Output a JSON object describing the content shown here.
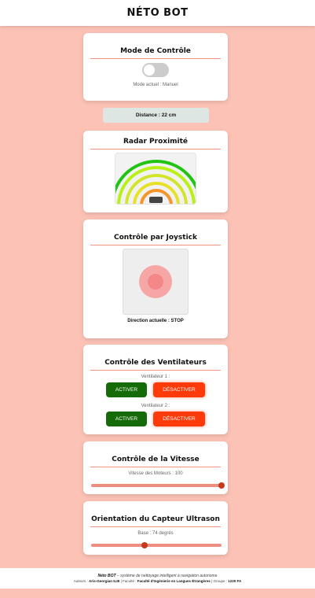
{
  "app": {
    "title": "NÉTO BOT"
  },
  "mode_card": {
    "title": "Mode de Contrôle",
    "status": "Mode actuel : Manuel",
    "toggle_on": false
  },
  "distance": {
    "text": "Distance : 22 cm"
  },
  "radar_card": {
    "title": "Radar Proximité",
    "arc_colors": [
      "#f5962a",
      "#d3e52b",
      "#b9f018",
      "#22c414"
    ]
  },
  "joystick_card": {
    "title": "Contrôle par Joystick",
    "direction": "Direction actuelle : STOP"
  },
  "fans_card": {
    "title": "Contrôle des Ventilateurs",
    "fans": [
      {
        "label": "Ventilateur 1 :",
        "on_label": "ACTIVER",
        "off_label": "DÉSACTIVER"
      },
      {
        "label": "Ventilateur 2 :",
        "on_label": "ACTIVER",
        "off_label": "DÉSACTIVER"
      }
    ]
  },
  "speed_card": {
    "title": "Contrôle de la Vitesse",
    "label": "Vitesse des Moteurs : 100",
    "value_fraction": 1.0
  },
  "sensor_card": {
    "title": "Orientation du Capteur Ultrason",
    "label": "Base : 74 degrés",
    "value_fraction": 0.41
  },
  "footer": {
    "brand": "Néto BOT",
    "tagline": " – système de nettoyage intelligent à navigation autonome",
    "authors_prefix": "Auteurs : ",
    "authors": "Aris-Georgian ILIE",
    "faculty_prefix": " | Faculté : ",
    "faculty": "Faculté d'Ingénierie en Langues Étrangères",
    "group_prefix": " | Groupe : ",
    "group": "1220 FA"
  },
  "colors": {
    "background": "#fcc2b6",
    "activate": "#166b09",
    "deactivate": "#ff3a0a",
    "accent_rule": "#f4937f"
  }
}
